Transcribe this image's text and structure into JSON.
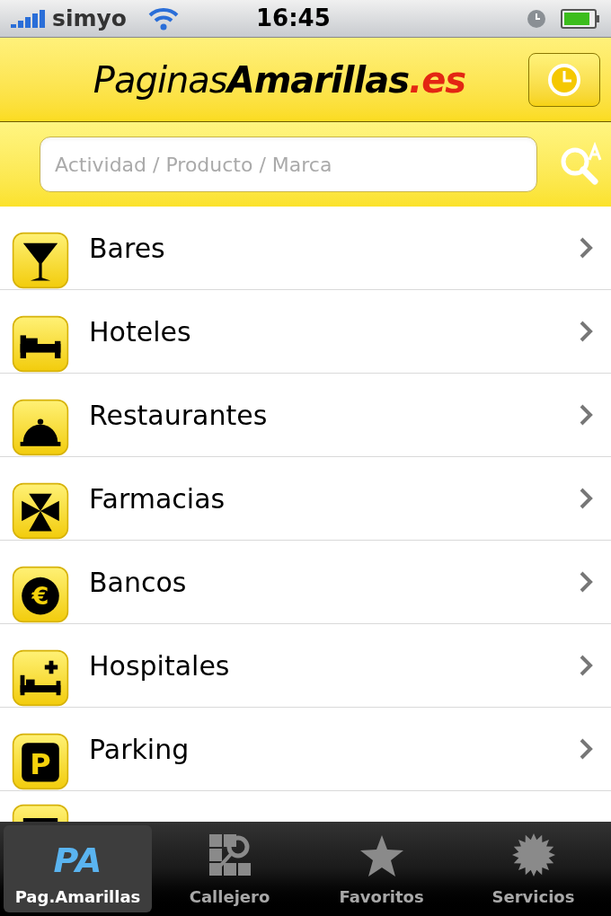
{
  "status_bar": {
    "carrier": "simyo",
    "time": "16:45"
  },
  "header": {
    "logo": [
      {
        "text": "Paginas",
        "kind": "plain"
      },
      {
        "text": "Amarillas",
        "kind": "bold"
      },
      {
        "text": ".es",
        "kind": "accent"
      }
    ]
  },
  "search": {
    "placeholder": "Actividad / Producto / Marca"
  },
  "categories": [
    {
      "label": "Bares",
      "kind": "full"
    },
    {
      "label": "Hoteles",
      "kind": "full"
    },
    {
      "label": "Restaurantes",
      "kind": "full"
    },
    {
      "label": "Farmacias",
      "kind": "full"
    },
    {
      "label": "Bancos",
      "kind": "full",
      "icon_text": "€"
    },
    {
      "label": "Hospitales",
      "kind": "full"
    },
    {
      "label": "Parking",
      "kind": "full",
      "icon_text": "P"
    },
    {
      "kind": "cut"
    }
  ],
  "tabs": [
    {
      "label": "Pag.Amarillas",
      "icon_text": "PA",
      "selected": true
    },
    {
      "label": "Callejero",
      "selected": false
    },
    {
      "label": "Favoritos",
      "selected": false
    },
    {
      "label": "Servicios",
      "selected": false
    }
  ]
}
